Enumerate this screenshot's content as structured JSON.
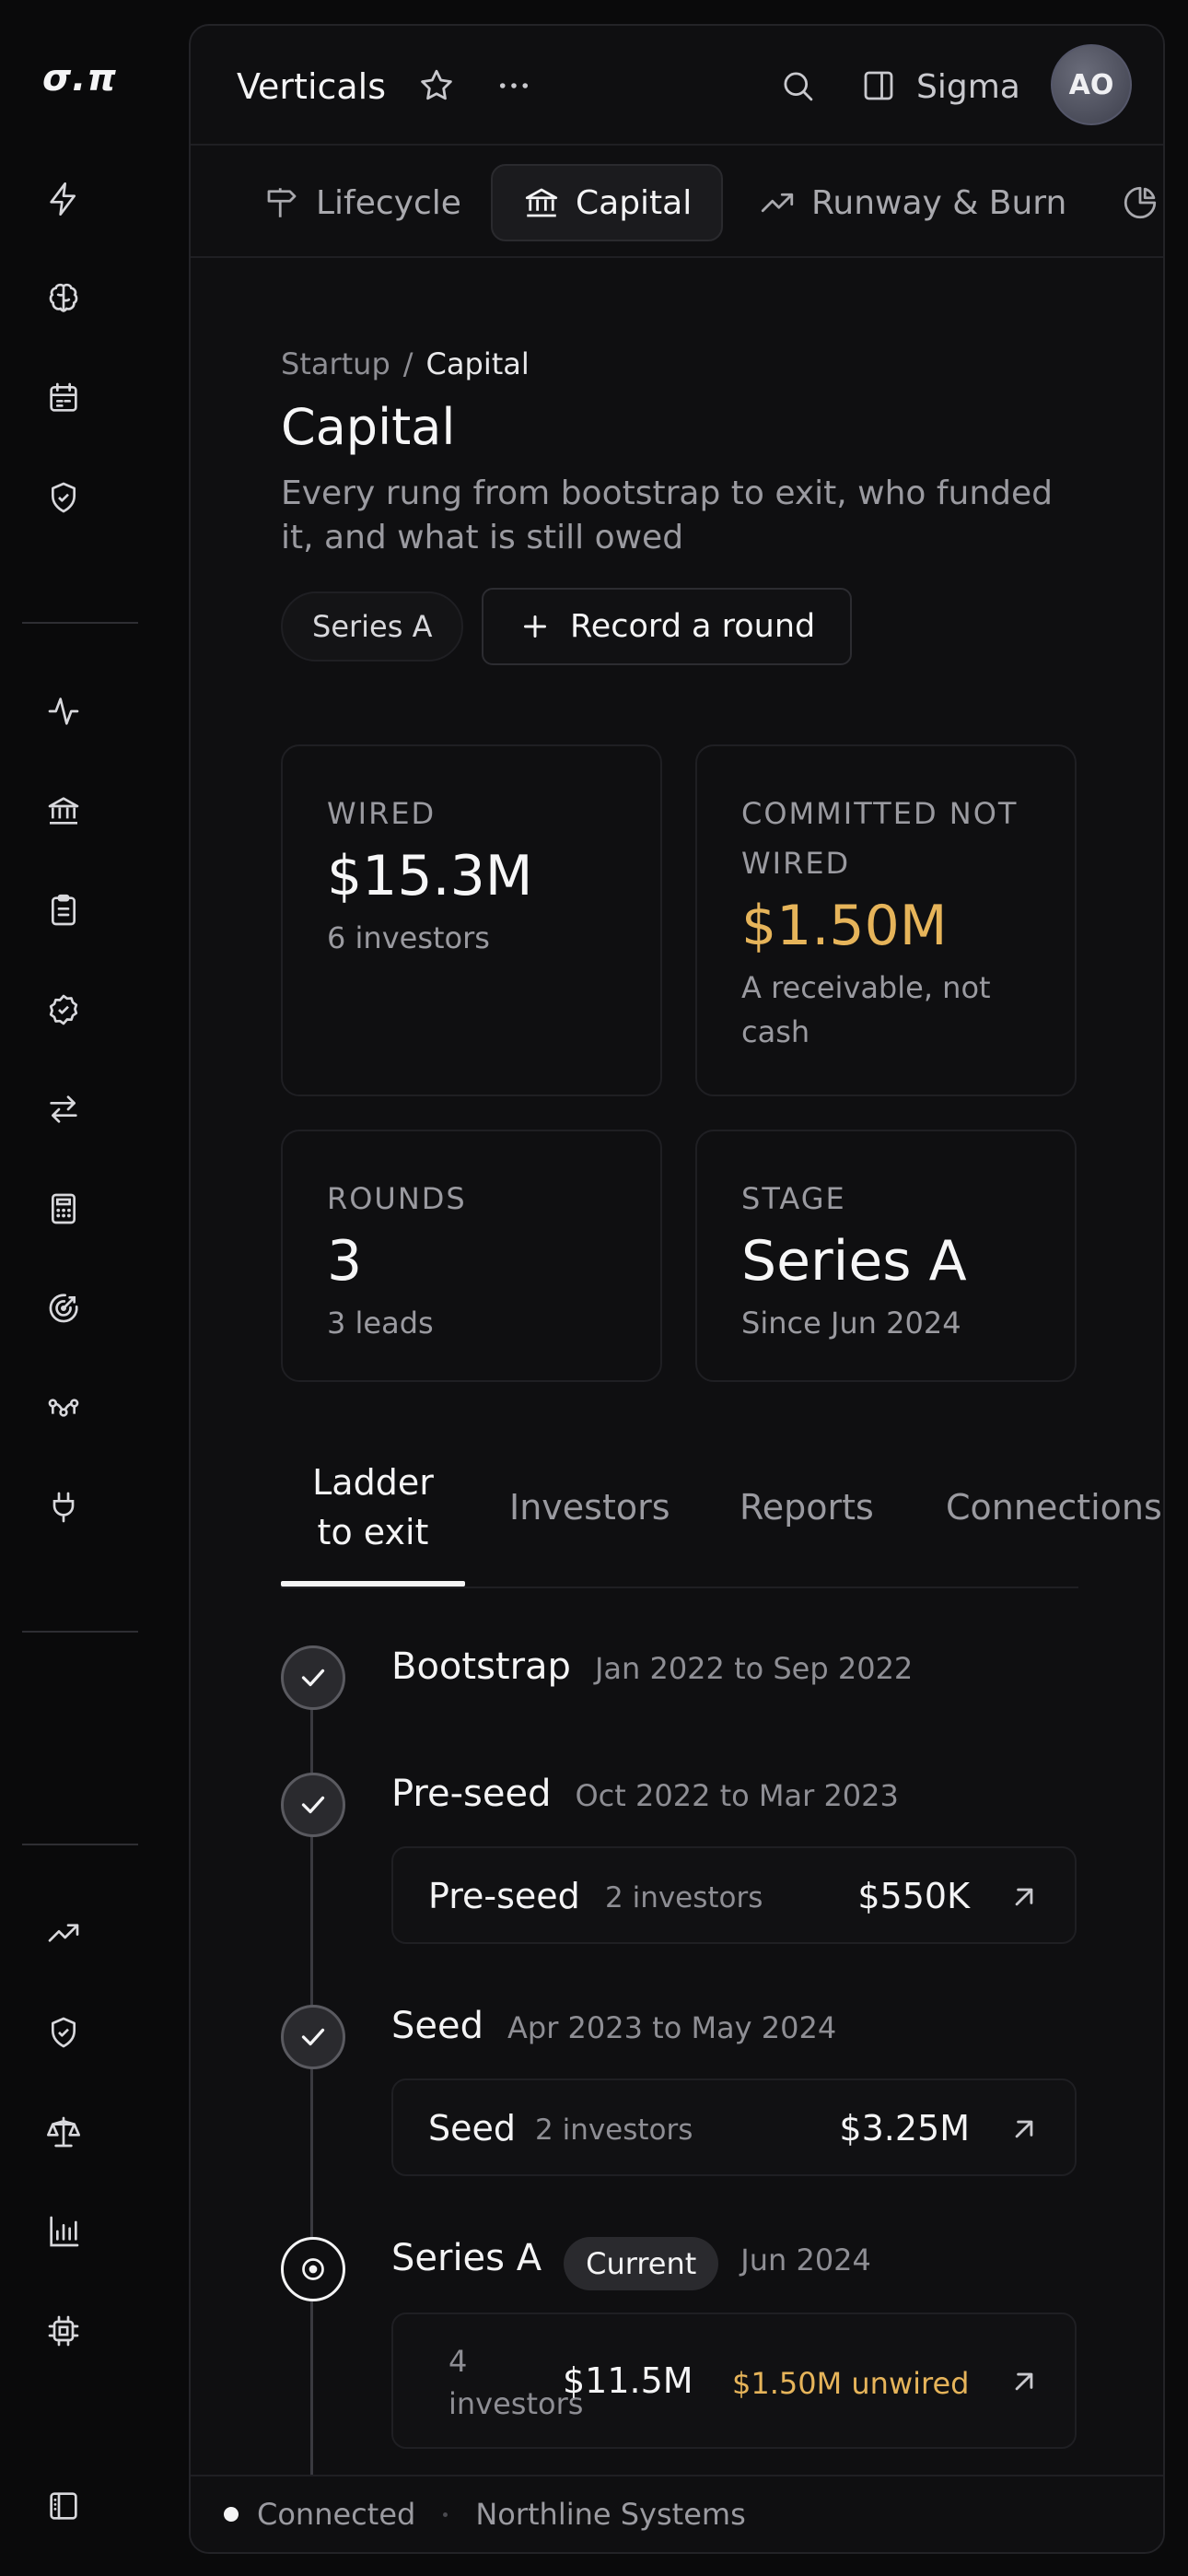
{
  "app": {
    "logo": "σ.π"
  },
  "rail": {
    "icons": [
      "bolt-icon",
      "brain-icon",
      "calendar-icon",
      "shield-check-icon",
      "activity-icon",
      "bank-icon",
      "clipboard-icon",
      "badge-check-icon",
      "arrows-exchange-icon",
      "calculator-icon",
      "target-icon",
      "network-icon",
      "plug-icon",
      "trending-up-icon",
      "shield-icon",
      "scale-icon",
      "bar-chart-icon",
      "chip-icon",
      "sidebar-toggle-icon"
    ]
  },
  "topbar": {
    "title": "Verticals",
    "user_name": "Sigma",
    "avatar_initials": "AO"
  },
  "vertical_tabs": [
    {
      "label": "Lifecycle",
      "icon": "signpost-icon"
    },
    {
      "label": "Capital",
      "icon": "bank-icon",
      "active": true
    },
    {
      "label": "Runway & Burn",
      "icon": "trending-up-icon"
    },
    {
      "label": "",
      "icon": "pie-chart-icon"
    }
  ],
  "breadcrumb": {
    "parent": "Startup",
    "separator": "/",
    "current": "Capital"
  },
  "page": {
    "title": "Capital",
    "subtitle": "Every rung from bootstrap to exit, who funded it, and what is still owed",
    "stage_chip": "Series A",
    "record_button": "Record a round"
  },
  "stats": [
    {
      "label": "WIRED",
      "value": "$15.3M",
      "note": "6 investors"
    },
    {
      "label": "COMMITTED NOT WIRED",
      "value": "$1.50M",
      "note": "A receivable, not cash",
      "accent": "#e6b45a"
    },
    {
      "label": "ROUNDS",
      "value": "3",
      "note": "3 leads"
    },
    {
      "label": "STAGE",
      "value": "Series A",
      "note": "Since Jun 2024"
    }
  ],
  "section_tabs": [
    {
      "label": "Ladder to exit",
      "active": true
    },
    {
      "label": "Investors"
    },
    {
      "label": "Reports"
    },
    {
      "label": "Connections"
    }
  ],
  "ladder": [
    {
      "stage": "Bootstrap",
      "dates": "Jan 2022 to Sep 2022",
      "status": "done"
    },
    {
      "stage": "Pre-seed",
      "dates": "Oct 2022 to Mar 2023",
      "status": "done",
      "round": {
        "name": "Pre-seed",
        "investors": "2 investors",
        "amount": "$550K"
      }
    },
    {
      "stage": "Seed",
      "dates": "Apr 2023 to May 2024",
      "status": "done",
      "round": {
        "name": "Seed",
        "investors": "2 investors",
        "amount": "$3.25M"
      }
    },
    {
      "stage": "Series A",
      "badge": "Current",
      "dates": "Jun 2024",
      "status": "current",
      "round": {
        "investors": "4 investors",
        "amount": "$11.5M",
        "unwired": "$1.50M unwired"
      }
    }
  ],
  "statusbar": {
    "status": "Connected",
    "org": "Northline Systems"
  },
  "colors": {
    "background": "#0a0a0b",
    "panel": "#0f0f11",
    "accent_amber": "#e6b45a"
  }
}
